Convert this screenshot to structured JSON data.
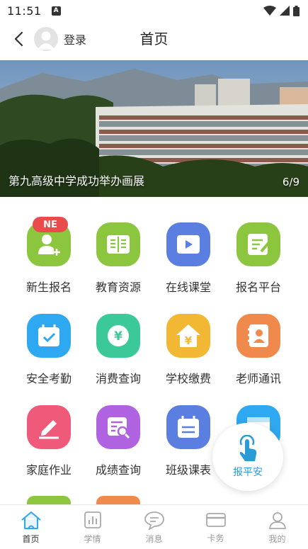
{
  "status_bar": {
    "time": "11:51",
    "notif_glyph": "A"
  },
  "header": {
    "login_label": "登录",
    "title": "首页"
  },
  "banner": {
    "caption": "第九高级中学成功举办画展",
    "index": "6/9"
  },
  "grid": {
    "items": [
      {
        "label": "新生报名",
        "icon": "user-add-icon",
        "color": "#8cc63e",
        "badge": "NE"
      },
      {
        "label": "教育资源",
        "icon": "book-icon",
        "color": "#8cc63e"
      },
      {
        "label": "在线课堂",
        "icon": "video-play-icon",
        "color": "#5a7fe0"
      },
      {
        "label": "报名平台",
        "icon": "edit-note-icon",
        "color": "#8cc63e"
      },
      {
        "label": "安全考勤",
        "icon": "calendar-check-icon",
        "color": "#2ea8f0"
      },
      {
        "label": "消费查询",
        "icon": "yuan-coin-icon",
        "color": "#3cc99a"
      },
      {
        "label": "学校缴费",
        "icon": "yuan-house-icon",
        "color": "#f2b834"
      },
      {
        "label": "老师通讯",
        "icon": "contact-book-icon",
        "color": "#f08a4c"
      },
      {
        "label": "家庭作业",
        "icon": "pencil-icon",
        "color": "#ef5a7a"
      },
      {
        "label": "成绩查询",
        "icon": "document-search-icon",
        "color": "#b063e0"
      },
      {
        "label": "班级课表",
        "icon": "calendar-list-icon",
        "color": "#5a7fe0"
      },
      {
        "label": "",
        "icon": "window-icon",
        "color": "#2ea8f0"
      }
    ]
  },
  "float_button": {
    "label": "报平安"
  },
  "tab_bar": {
    "tabs": [
      {
        "label": "首页",
        "icon": "home-icon",
        "active": true
      },
      {
        "label": "学情",
        "icon": "chart-icon",
        "active": false
      },
      {
        "label": "消息",
        "icon": "message-icon",
        "active": false
      },
      {
        "label": "卡务",
        "icon": "card-icon",
        "active": false
      },
      {
        "label": "我的",
        "icon": "profile-icon",
        "active": false
      }
    ]
  }
}
